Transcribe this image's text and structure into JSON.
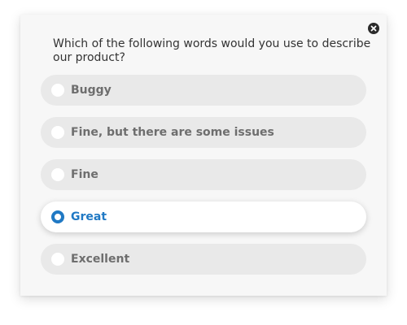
{
  "survey": {
    "question": "Which of the following words would you use to describe our product?",
    "selected_index": 3,
    "options": [
      {
        "label": "Buggy",
        "selected": false
      },
      {
        "label": "Fine, but there are some issues",
        "selected": false
      },
      {
        "label": "Fine",
        "selected": false
      },
      {
        "label": "Great",
        "selected": true
      },
      {
        "label": "Excellent",
        "selected": false
      }
    ]
  },
  "icons": {
    "close": "close-icon",
    "radio": "radio-icon"
  },
  "colors": {
    "accent": "#2079c4",
    "option_background": "#e9e9e9",
    "selected_background": "#ffffff",
    "label_text": "#6e6e6e",
    "question_text": "#333333",
    "close_button": "#2b2b2b"
  }
}
